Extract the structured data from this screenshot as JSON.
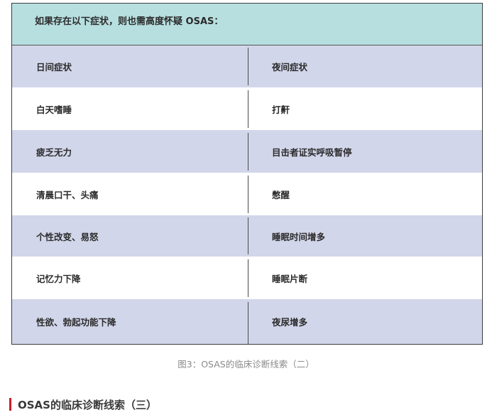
{
  "table": {
    "header": "如果存在以下症状，则也需高度怀疑 OSAS：",
    "rows": [
      {
        "left": "日间症状",
        "right": "夜间症状"
      },
      {
        "left": "白天嗜睡",
        "right": "打鼾"
      },
      {
        "left": "疲乏无力",
        "right": "目击者证实呼吸暂停"
      },
      {
        "left": "清晨口干、头痛",
        "right": "憋醒"
      },
      {
        "left": "个性改变、易怒",
        "right": "睡眠时间增多"
      },
      {
        "left": "记忆力下降",
        "right": "睡眠片断"
      },
      {
        "left": "性欲、勃起功能下降",
        "right": "夜尿增多"
      }
    ]
  },
  "caption": "图3：OSAS的临床诊断线索（二）",
  "section_heading": "OSAS的临床诊断线索（三）",
  "colors": {
    "header_band": "#b7dfe0",
    "row_shaded": "#d2d6ea",
    "accent": "#c81e2a"
  }
}
